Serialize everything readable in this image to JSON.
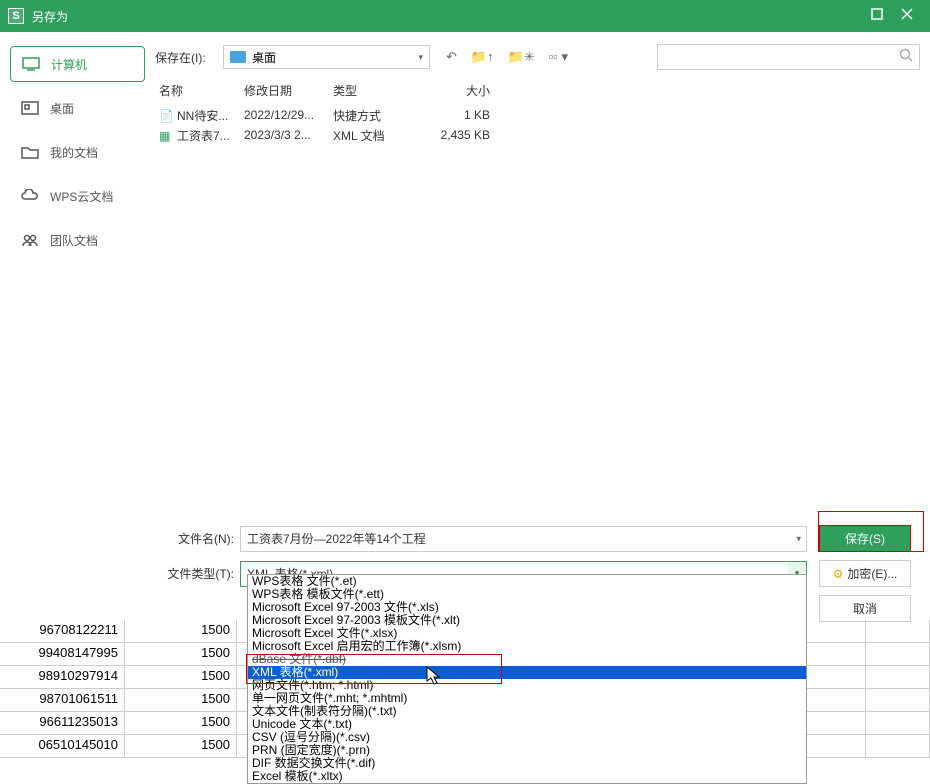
{
  "window": {
    "title": "另存为"
  },
  "sidebar": {
    "items": [
      {
        "label": "计算机"
      },
      {
        "label": "桌面"
      },
      {
        "label": "我的文档"
      },
      {
        "label": "WPS云文档"
      },
      {
        "label": "团队文档"
      }
    ]
  },
  "topbar": {
    "save_in_label": "保存在(I):",
    "location": "桌面"
  },
  "file_list": {
    "headers": {
      "name": "名称",
      "date": "修改日期",
      "type": "类型",
      "size": "大小"
    },
    "rows": [
      {
        "name": "NN待安...",
        "date": "2022/12/29...",
        "type": "快捷方式",
        "size": "1 KB"
      },
      {
        "name": "工资表7...",
        "date": "2023/3/3 2...",
        "type": "XML 文档",
        "size": "2,435 KB"
      }
    ]
  },
  "form": {
    "filename_label": "文件名(N):",
    "filename_value": "工资表7月份—2022年等14个工程",
    "filetype_label": "文件类型(T):",
    "filetype_value": "XML 表格(*.xml)",
    "save_btn": "保存(S)",
    "encrypt_btn": "加密(E)...",
    "cancel_btn": "取消"
  },
  "filetype_options": [
    "WPS表格 文件(*.et)",
    "WPS表格 模板文件(*.ett)",
    "Microsoft Excel 97-2003 文件(*.xls)",
    "Microsoft Excel 97-2003 模板文件(*.xlt)",
    "Microsoft Excel 文件(*.xlsx)",
    "Microsoft Excel 启用宏的工作簿(*.xlsm)",
    "dBase 文件(*.dbf)",
    "XML 表格(*.xml)",
    "网页文件(*.htm; *.html)",
    "单一网页文件(*.mht; *.mhtml)",
    "文本文件(制表符分隔)(*.txt)",
    "Unicode 文本(*.txt)",
    "CSV (逗号分隔)(*.csv)",
    "PRN (固定宽度)(*.prn)",
    "DIF 数据交换文件(*.dif)",
    "Excel 模板(*.xltx)"
  ],
  "sheet_rows": [
    {
      "c1": "96708122211",
      "c2": "1500"
    },
    {
      "c1": "99408147995",
      "c2": "1500"
    },
    {
      "c1": "98910297914",
      "c2": "1500"
    },
    {
      "c1": "98701061511",
      "c2": "1500"
    },
    {
      "c1": "96611235013",
      "c2": "1500"
    },
    {
      "c1": "06510145010",
      "c2": "1500"
    }
  ]
}
